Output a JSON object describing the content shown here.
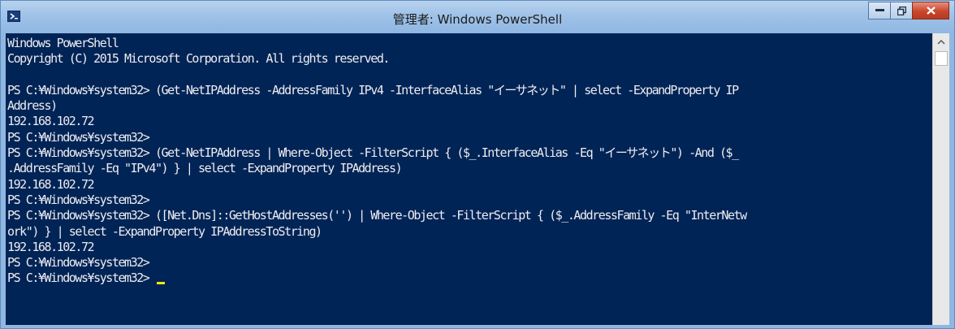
{
  "window": {
    "title": "管理者: Windows PowerShell",
    "icon": "powershell-icon",
    "controls": {
      "minimize": "minimize-icon",
      "maximize": "maximize-icon",
      "close": "close-icon"
    }
  },
  "console": {
    "lines": [
      "Windows PowerShell",
      "Copyright (C) 2015 Microsoft Corporation. All rights reserved.",
      "",
      "PS C:¥Windows¥system32> (Get-NetIPAddress -AddressFamily IPv4 -InterfaceAlias \"イーサネット\" | select -ExpandProperty IP",
      "Address)",
      "192.168.102.72",
      "PS C:¥Windows¥system32>",
      "PS C:¥Windows¥system32> (Get-NetIPAddress | Where-Object -FilterScript { ($_.InterfaceAlias -Eq \"イーサネット\") -And ($_",
      ".AddressFamily -Eq \"IPv4\") } | select -ExpandProperty IPAddress)",
      "192.168.102.72",
      "PS C:¥Windows¥system32>",
      "PS C:¥Windows¥system32> ([Net.Dns]::GetHostAddresses('') | Where-Object -FilterScript { ($_.AddressFamily -Eq \"InterNetw",
      "ork\") } | select -ExpandProperty IPAddressToString)",
      "192.168.102.72",
      "PS C:¥Windows¥system32>"
    ],
    "current_prompt": "PS C:¥Windows¥system32> ",
    "colors": {
      "background": "#012456",
      "text": "#eeedf0",
      "cursor": "#eeee00"
    }
  },
  "scrollbar": {
    "up_icon": "chevron-up-icon"
  }
}
